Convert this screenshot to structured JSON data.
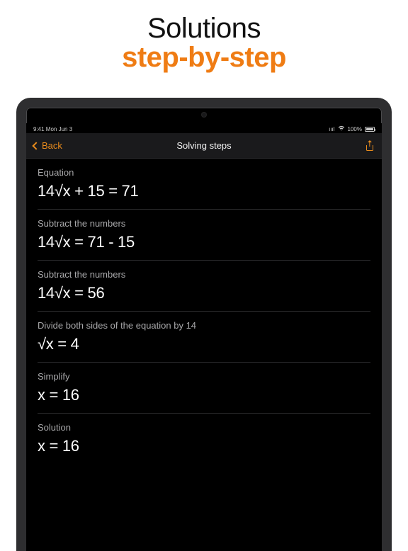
{
  "marketing": {
    "line1": "Solutions",
    "line2": "step-by-step"
  },
  "statusbar": {
    "time": "9:41  Mon Jun 3",
    "wifi_signal": "▂▄▆",
    "wifi_icon": "✦",
    "percent": "100%"
  },
  "navbar": {
    "back_label": "Back",
    "title": "Solving steps"
  },
  "steps": [
    {
      "label": "Equation",
      "expr": "14√x + 15 = 71"
    },
    {
      "label": "Subtract the numbers",
      "expr": "14√x = 71 - 15"
    },
    {
      "label": "Subtract the numbers",
      "expr": "14√x = 56"
    },
    {
      "label": "Divide both sides of the equation by 14",
      "expr": "√x = 4"
    },
    {
      "label": "Simplify",
      "expr": "x = 16"
    },
    {
      "label": "Solution",
      "expr": "x = 16"
    }
  ]
}
